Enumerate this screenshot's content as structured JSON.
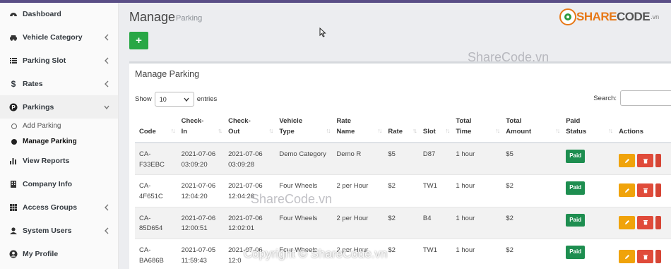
{
  "sidebar": {
    "items": [
      {
        "label": "Dashboard",
        "icon": "tachometer-icon"
      },
      {
        "label": "Vehicle Category",
        "icon": "car-icon"
      },
      {
        "label": "Parking Slot",
        "icon": "list-icon"
      },
      {
        "label": "Rates",
        "icon": "dollar-icon"
      },
      {
        "label": "Parkings",
        "icon": "parking-icon"
      },
      {
        "label": "View Reports",
        "icon": "bar-chart-icon"
      },
      {
        "label": "Company Info",
        "icon": "building-icon"
      },
      {
        "label": "Access Groups",
        "icon": "grid-icon"
      },
      {
        "label": "System Users",
        "icon": "user-secret-icon"
      },
      {
        "label": "My Profile",
        "icon": "user-circle-icon"
      }
    ],
    "sub_items": [
      {
        "label": "Add Parking"
      },
      {
        "label": "Manage Parking"
      }
    ]
  },
  "header": {
    "title": "Manage",
    "subtitle": "Parking",
    "add_label": "+"
  },
  "card": {
    "title": "Manage Parking",
    "show_label": "Show",
    "show_value": "10",
    "entries_label": "entries",
    "search_label": "Search:"
  },
  "table": {
    "headers": [
      [
        "Code",
        ""
      ],
      [
        "Check-",
        "In"
      ],
      [
        "Check-",
        "Out"
      ],
      [
        "Vehicle",
        "Type"
      ],
      [
        "Rate",
        "Name"
      ],
      [
        "Rate",
        ""
      ],
      [
        "Slot",
        ""
      ],
      [
        "Total",
        "Time"
      ],
      [
        "Total",
        "Amount"
      ],
      [
        "Paid",
        "Status"
      ],
      [
        "Actions",
        ""
      ]
    ],
    "rows": [
      {
        "code": [
          "CA-",
          "F33EBC"
        ],
        "checkin": [
          "2021-07-06",
          "03:09:20"
        ],
        "checkout": [
          "2021-07-06",
          "03:09:28"
        ],
        "vehicle_type": "Demo Category",
        "rate_name": "Demo R",
        "rate": "$5",
        "slot": "D87",
        "total_time": "1 hour",
        "total_amount": "$5",
        "paid": "Paid"
      },
      {
        "code": [
          "CA-4F651C",
          ""
        ],
        "checkin": [
          "2021-07-06",
          "12:04:20"
        ],
        "checkout": [
          "2021-07-06",
          "12:04:26"
        ],
        "vehicle_type": "Four Wheels",
        "rate_name": "2 per Hour",
        "rate": "$2",
        "slot": "TW1",
        "total_time": "1 hour",
        "total_amount": "$2",
        "paid": "Paid"
      },
      {
        "code": [
          "CA-85D654",
          ""
        ],
        "checkin": [
          "2021-07-06",
          "12:00:51"
        ],
        "checkout": [
          "2021-07-06",
          "12:02:01"
        ],
        "vehicle_type": "Four Wheels",
        "rate_name": "2 per Hour",
        "rate": "$2",
        "slot": "B4",
        "total_time": "1 hour",
        "total_amount": "$2",
        "paid": "Paid"
      },
      {
        "code": [
          "CA-",
          "BA686B"
        ],
        "checkin": [
          "2021-07-05",
          "11:59:43"
        ],
        "checkout": [
          "2021-07-06",
          "12:0"
        ],
        "vehicle_type": "Four Wheels",
        "rate_name": "2 per Hour",
        "rate": "$2",
        "slot": "TW1",
        "total_time": "1 hour",
        "total_amount": "$2",
        "paid": "Paid"
      }
    ]
  },
  "watermarks": {
    "logo_main": "SHARE",
    "logo_second": "CODE",
    "logo_small": ".vn",
    "wm1": "ShareCode.vn",
    "wm2": "ShareCode.vn",
    "copyright": "Copyright © ShareCode.vn"
  },
  "colors": {
    "accent": "#28a745",
    "paid_badge": "#1e8e50",
    "edit": "#f0a30a",
    "delete": "#e04b3a",
    "topbar": "#5a4e86"
  }
}
